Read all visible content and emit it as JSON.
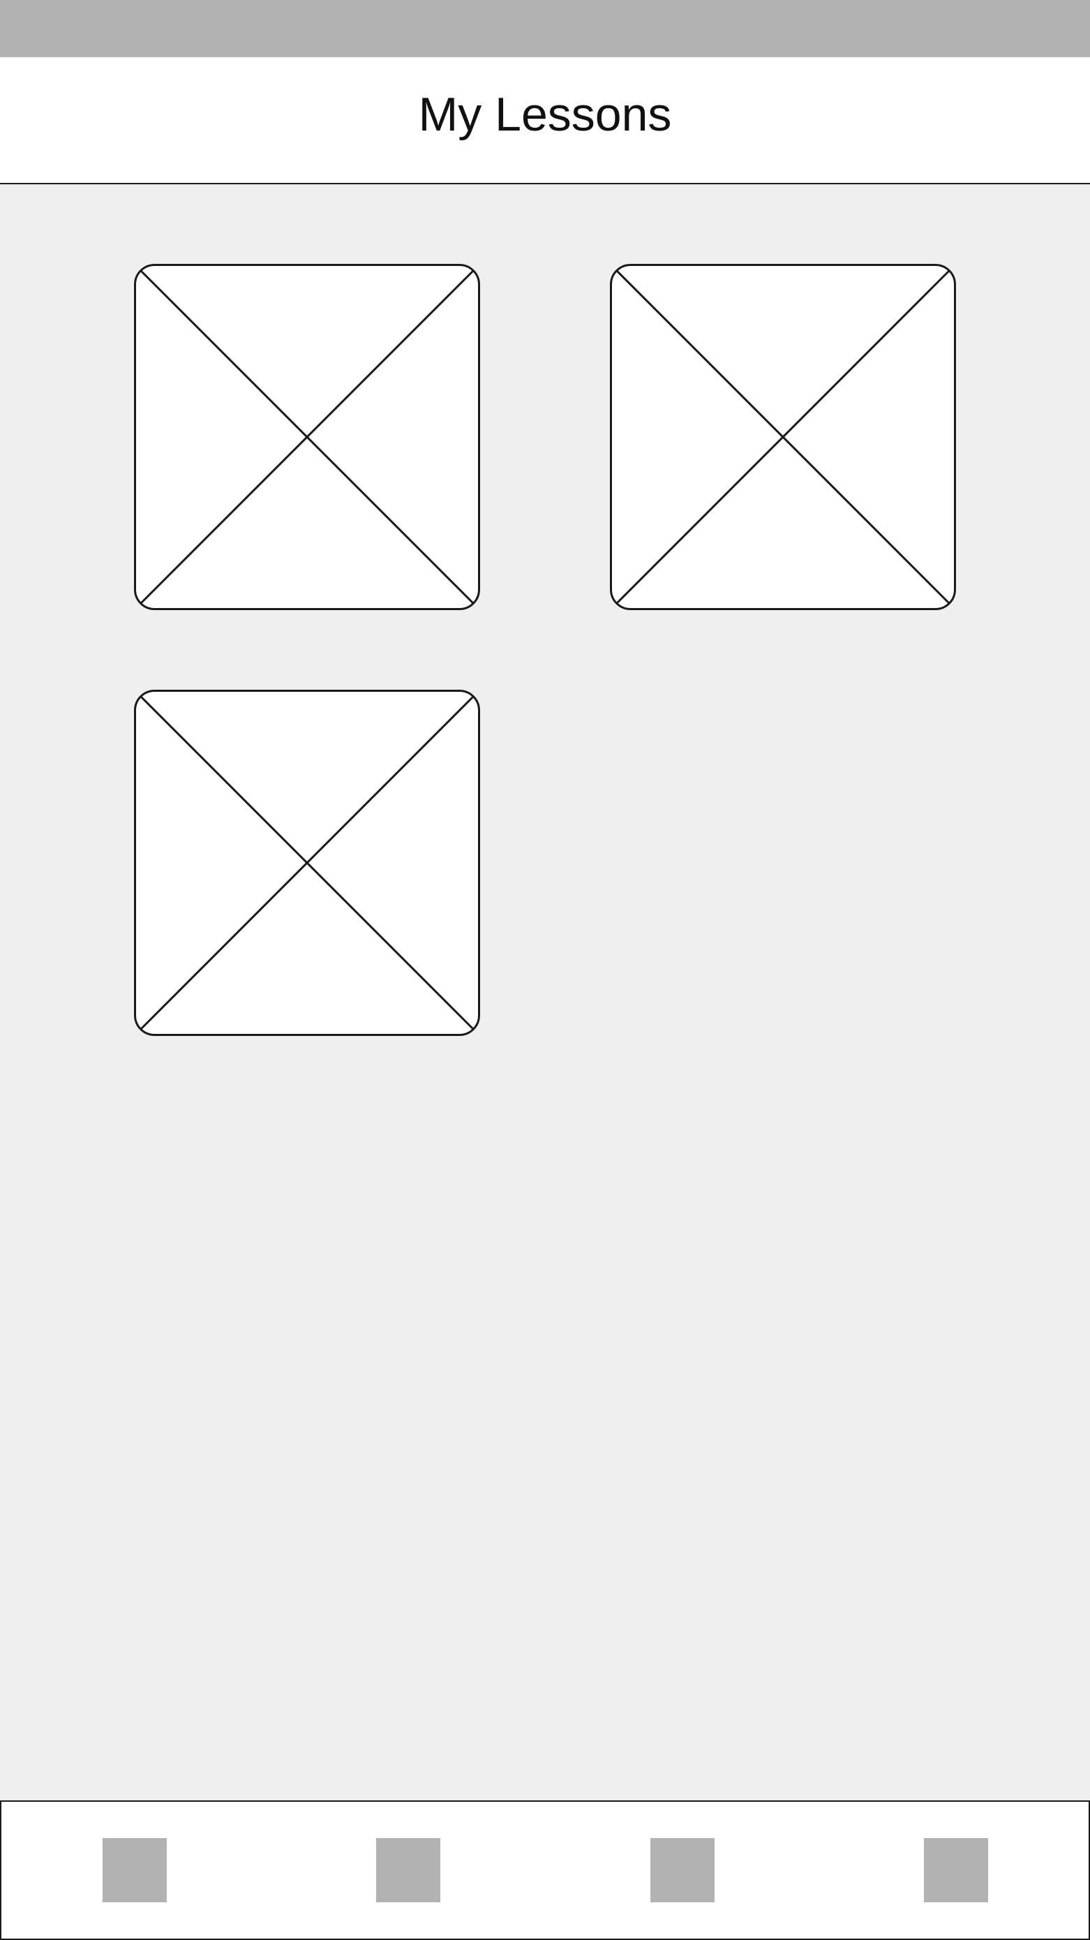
{
  "header": {
    "title": "My Lessons"
  },
  "lessons": {
    "items": [
      {
        "thumbnail": "image-placeholder-icon"
      },
      {
        "thumbnail": "image-placeholder-icon"
      },
      {
        "thumbnail": "image-placeholder-icon"
      }
    ]
  },
  "tab_bar": {
    "items": [
      {
        "icon": "tab-placeholder-icon"
      },
      {
        "icon": "tab-placeholder-icon"
      },
      {
        "icon": "tab-placeholder-icon"
      },
      {
        "icon": "tab-placeholder-icon"
      }
    ]
  },
  "colors": {
    "status_bar": "#b2b2b2",
    "background": "#efefef",
    "surface": "#ffffff",
    "stroke": "#1a1a1a",
    "tab_icon": "#b2b2b2"
  }
}
